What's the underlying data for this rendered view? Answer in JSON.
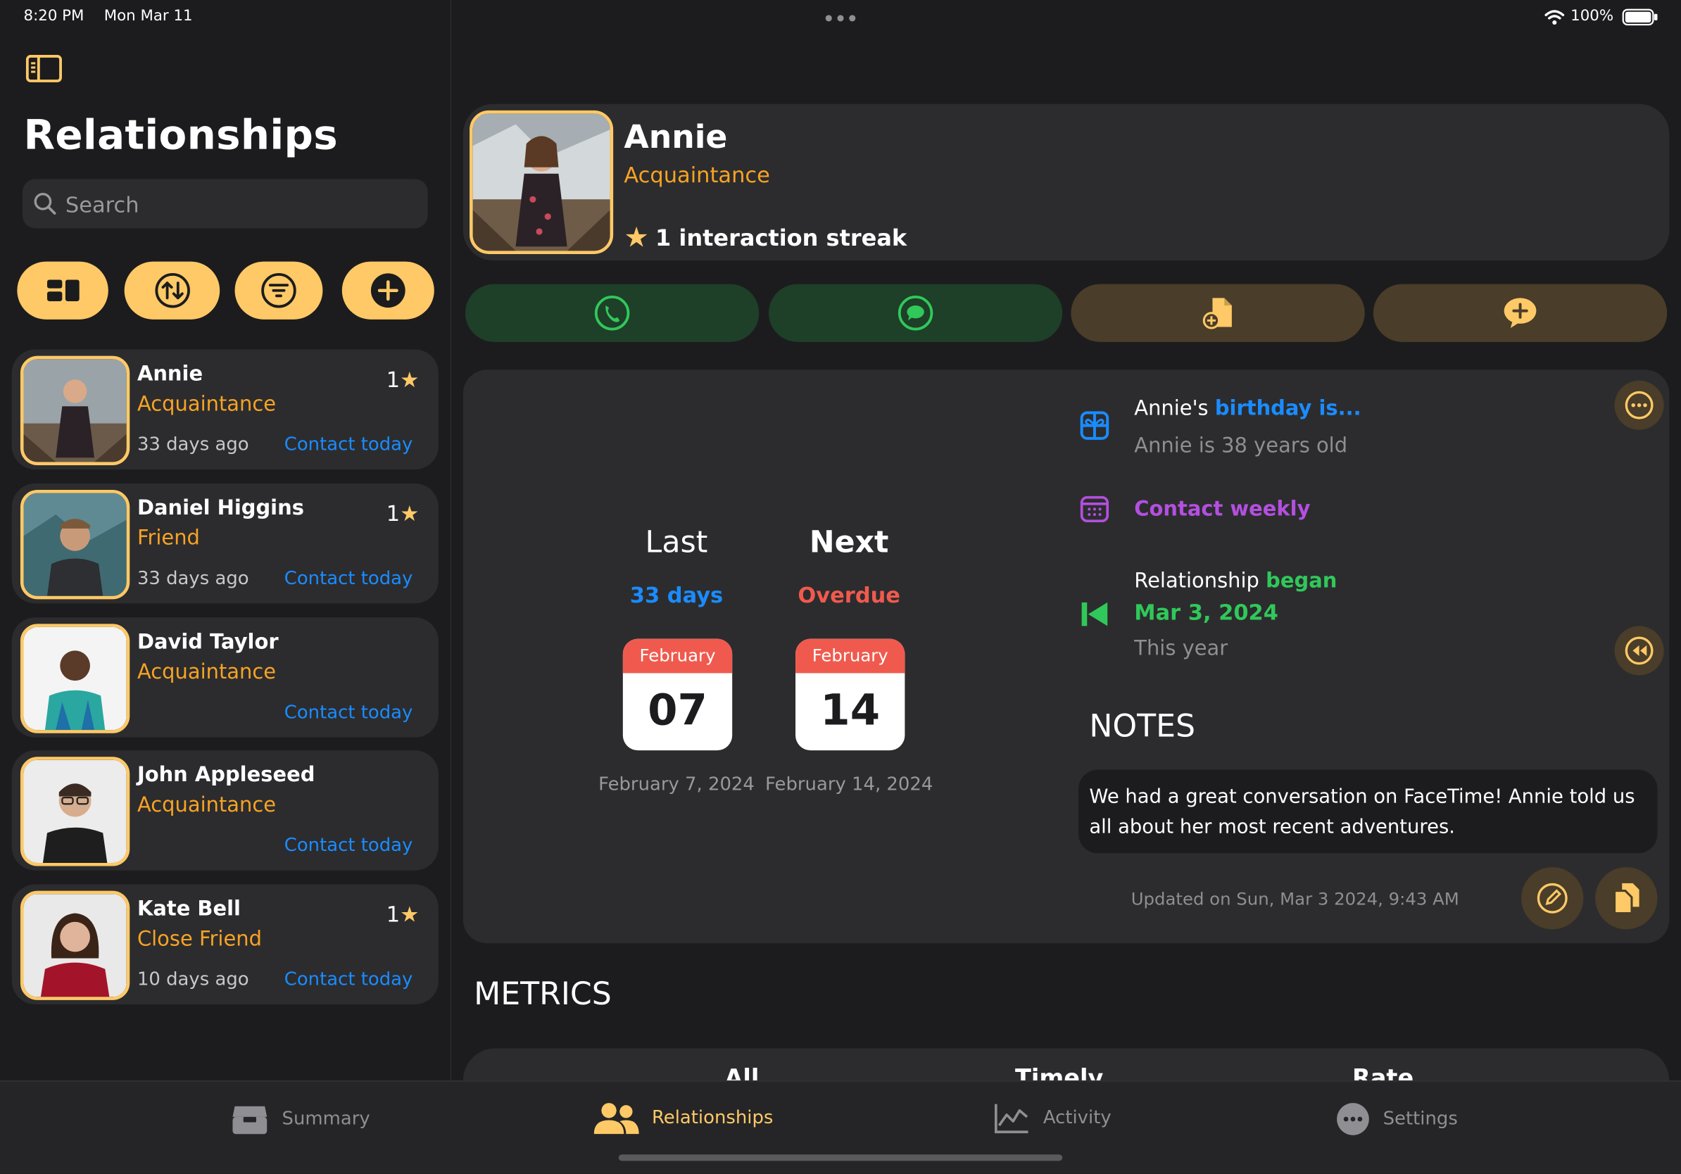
{
  "status_bar": {
    "time": "8:20 PM",
    "date": "Mon Mar 11",
    "battery": "100%"
  },
  "sidebar": {
    "title": "Relationships",
    "search_placeholder": "Search",
    "toolbar_icons": [
      "layout-icon",
      "sort-icon",
      "filter-icon",
      "add-icon"
    ],
    "contacts": [
      {
        "name": "Annie",
        "relationship": "Acquaintance",
        "last_contact": "33 days ago",
        "action": "Contact today",
        "streak": "1"
      },
      {
        "name": "Daniel Higgins",
        "relationship": "Friend",
        "last_contact": "33 days ago",
        "action": "Contact today",
        "streak": "1"
      },
      {
        "name": "David Taylor",
        "relationship": "Acquaintance",
        "last_contact": "",
        "action": "Contact today",
        "streak": ""
      },
      {
        "name": "John Appleseed",
        "relationship": "Acquaintance",
        "last_contact": "",
        "action": "Contact today",
        "streak": ""
      },
      {
        "name": "Kate Bell",
        "relationship": "Close Friend",
        "last_contact": "10 days ago",
        "action": "Contact today",
        "streak": "1"
      }
    ]
  },
  "profile": {
    "name": "Annie",
    "relationship": "Acquaintance",
    "streak": "1 interaction streak"
  },
  "actions": [
    "phone-icon",
    "message-icon",
    "add-document-icon",
    "add-note-icon"
  ],
  "contact_info": {
    "last_label": "Last",
    "last_value": "33 days",
    "next_label": "Next",
    "next_value": "Overdue",
    "last_month": "February",
    "last_day": "07",
    "last_full": "February 7, 2024",
    "next_month": "February",
    "next_day": "14",
    "next_full": "February 14, 2024"
  },
  "details": {
    "birthday_prefix": "Annie's",
    "birthday_link": "birthday is...",
    "age": "Annie is 38 years old",
    "frequency": "Contact weekly",
    "began_prefix": "Relationship",
    "began_word": "began",
    "began_date": "Mar 3, 2024",
    "began_sub": "This year"
  },
  "notes": {
    "heading": "NOTES",
    "text": "We had a great conversation on FaceTime! Annie told us all about her most recent adventures.",
    "updated": "Updated on Sun, Mar 3 2024, 9:43 AM"
  },
  "metrics": {
    "heading": "METRICS",
    "columns": [
      "All",
      "Timely",
      "Rate"
    ]
  },
  "tabbar": {
    "tabs": [
      {
        "label": "Summary",
        "active": false
      },
      {
        "label": "Relationships",
        "active": true
      },
      {
        "label": "Activity",
        "active": false
      },
      {
        "label": "Settings",
        "active": false
      }
    ]
  },
  "colors": {
    "accent": "#fec966",
    "relationship": "#f7a325",
    "link_blue": "#1a8cff",
    "overdue_red": "#f05a4e",
    "frequency_purple": "#b44fe0",
    "began_green": "#30c85a"
  }
}
